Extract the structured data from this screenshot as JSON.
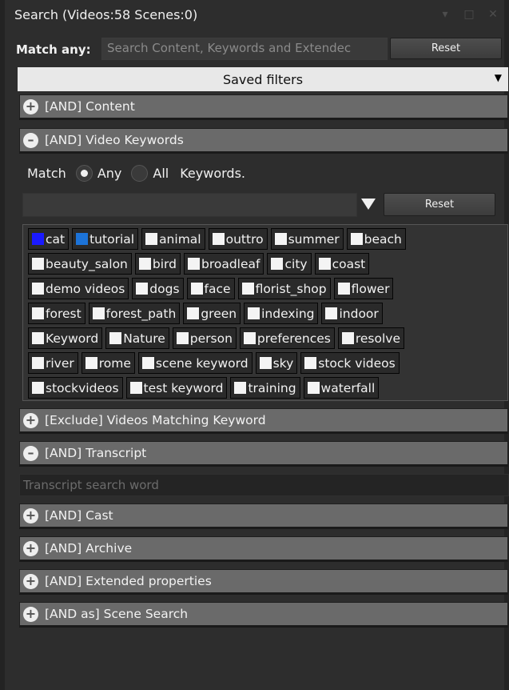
{
  "window": {
    "title": "Search (Videos:58 Scenes:0)",
    "controls": [
      "▾",
      "□",
      "✕"
    ]
  },
  "match": {
    "label": "Match any:",
    "placeholder": "Search Content, Keywords and Extendec",
    "reset_label": "Reset"
  },
  "saved_filters": {
    "label": "Saved filters",
    "icon": "chevron-down-icon"
  },
  "sections": {
    "content": {
      "label": "[AND] Content",
      "icon": "plus"
    },
    "video_keywords": {
      "label": "[AND] Video Keywords",
      "icon": "minus"
    },
    "exclude": {
      "label": "[Exclude] Videos Matching Keyword",
      "icon": "plus"
    },
    "transcript": {
      "label": "[AND] Transcript",
      "icon": "minus"
    },
    "cast": {
      "label": "[AND] Cast",
      "icon": "plus"
    },
    "archive": {
      "label": "[AND] Archive",
      "icon": "plus"
    },
    "extended": {
      "label": "[AND] Extended properties",
      "icon": "plus"
    },
    "scene": {
      "label": "[AND as] Scene Search",
      "icon": "plus"
    }
  },
  "keywords": {
    "match_label": "Match",
    "any_label": "Any",
    "all_label": "All",
    "suffix_label": "Keywords.",
    "selected_mode": "Any",
    "reset_label": "Reset",
    "tags": [
      [
        "cat",
        "tutorial",
        "animal",
        "outtro",
        "summer",
        "beach"
      ],
      [
        "beauty_salon",
        "bird",
        "broadleaf",
        "city",
        "coast"
      ],
      [
        "demo videos",
        "dogs",
        "face",
        "florist_shop",
        "flower"
      ],
      [
        "forest",
        "forest_path",
        "green",
        "indexing",
        "indoor"
      ],
      [
        "Keyword",
        "Nature",
        "person",
        "preferences",
        "resolve"
      ],
      [
        "river",
        "rome",
        "scene keyword",
        "sky",
        "stock videos"
      ],
      [
        "stockvideos",
        "test keyword",
        "training",
        "waterfall"
      ]
    ],
    "tag_colors": {
      "cat": "#1a1aff",
      "tutorial": "#1c73d8",
      "default": "#f4f4f4"
    }
  },
  "transcript": {
    "placeholder": "Transcript search word"
  }
}
